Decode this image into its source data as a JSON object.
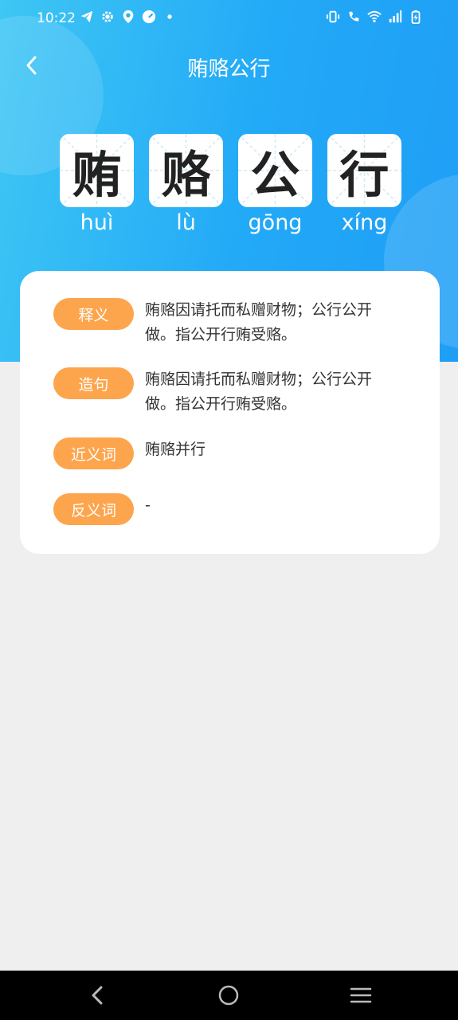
{
  "status_bar": {
    "time": "10:22",
    "left_icons": [
      "telegram-icon",
      "gear-icon",
      "location-pin-icon",
      "speedometer-icon",
      "dot-icon"
    ],
    "right_icons": [
      "vibrate-icon",
      "wifi-call-icon",
      "wifi-icon",
      "signal-icon",
      "battery-charging-icon"
    ]
  },
  "header": {
    "title": "贿赂公行",
    "back_icon": "chevron-left-icon"
  },
  "idiom": {
    "characters": [
      {
        "char": "贿",
        "pinyin": "huì"
      },
      {
        "char": "赂",
        "pinyin": "lù"
      },
      {
        "char": "公",
        "pinyin": "gōng"
      },
      {
        "char": "行",
        "pinyin": "xíng"
      }
    ]
  },
  "details": [
    {
      "label": "释义",
      "text": "贿赂因请托而私赠财物；公行公开做。指公开行贿受赂。"
    },
    {
      "label": "造句",
      "text": "贿赂因请托而私赠财物；公行公开做。指公开行贿受赂。"
    },
    {
      "label": "近义词",
      "text": "贿赂并行"
    },
    {
      "label": "反义词",
      "text": "-"
    }
  ],
  "colors": {
    "header_gradient_start": "#3ec6f4",
    "header_gradient_end": "#1f9ef6",
    "badge": "#fda54d",
    "background": "#efefef"
  },
  "nav_bar": {
    "icons": [
      "back-triangle-icon",
      "home-circle-icon",
      "menu-lines-icon"
    ]
  }
}
